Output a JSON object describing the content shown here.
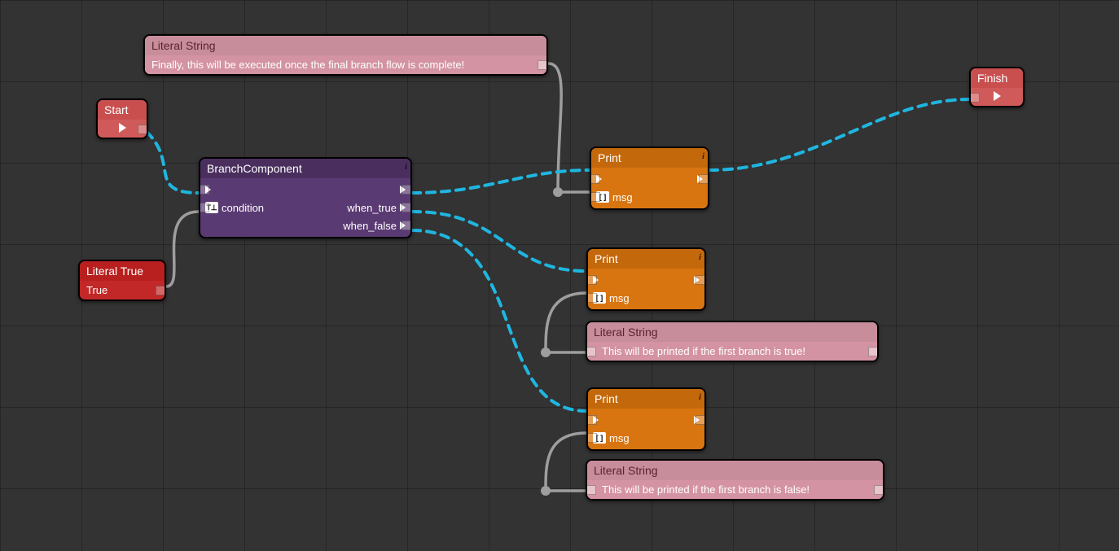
{
  "nodes": {
    "start": {
      "title": "Start"
    },
    "finish": {
      "title": "Finish"
    },
    "literal_true": {
      "title": "Literal True",
      "value": "True"
    },
    "branch": {
      "title": "BranchComponent",
      "condition_label": "condition",
      "when_true_label": "when_true",
      "when_false_label": "when_false"
    },
    "literal_string_top": {
      "title": "Literal String",
      "value": "Finally, this will be executed once the final branch flow is complete!"
    },
    "literal_string_mid": {
      "title": "Literal String",
      "value": "This will be printed if the first branch is true!"
    },
    "literal_string_bot": {
      "title": "Literal String",
      "value": "This will be printed if the first branch is false!"
    },
    "print1": {
      "title": "Print",
      "msg_label": "msg"
    },
    "print2": {
      "title": "Print",
      "msg_label": "msg"
    },
    "print3": {
      "title": "Print",
      "msg_label": "msg"
    }
  }
}
